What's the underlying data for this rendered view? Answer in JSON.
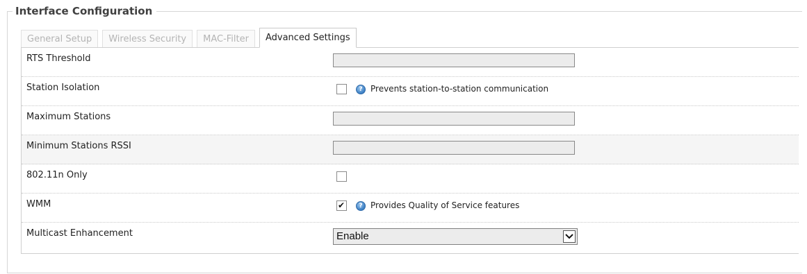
{
  "section": {
    "title": "Interface Configuration"
  },
  "tabs": [
    {
      "label": "General Setup",
      "active": false
    },
    {
      "label": "Wireless Security",
      "active": false
    },
    {
      "label": "MAC-Filter",
      "active": false
    },
    {
      "label": "Advanced Settings",
      "active": true
    }
  ],
  "settings": {
    "rts_threshold": {
      "label": "RTS Threshold",
      "value": ""
    },
    "station_isolation": {
      "label": "Station Isolation",
      "checked": false,
      "help_icon": "help-icon",
      "description": "Prevents station-to-station communication"
    },
    "maximum_stations": {
      "label": "Maximum Stations",
      "value": ""
    },
    "minimum_stations_rssi": {
      "label": "Minimum Stations RSSI",
      "value": ""
    },
    "n_only": {
      "label": "802.11n Only",
      "checked": false
    },
    "wmm": {
      "label": "WMM",
      "checked": true,
      "check_glyph": "✔",
      "help_icon": "help-icon",
      "description": "Provides Quality of Service features"
    },
    "multicast_enhancement": {
      "label": "Multicast Enhancement",
      "selected": "Enable"
    }
  },
  "icons": {
    "help_glyph": "?"
  },
  "colors": {
    "help_icon": "#3b7fc4",
    "alt_row": "#f5f5f5",
    "input_bg": "#ececec"
  }
}
